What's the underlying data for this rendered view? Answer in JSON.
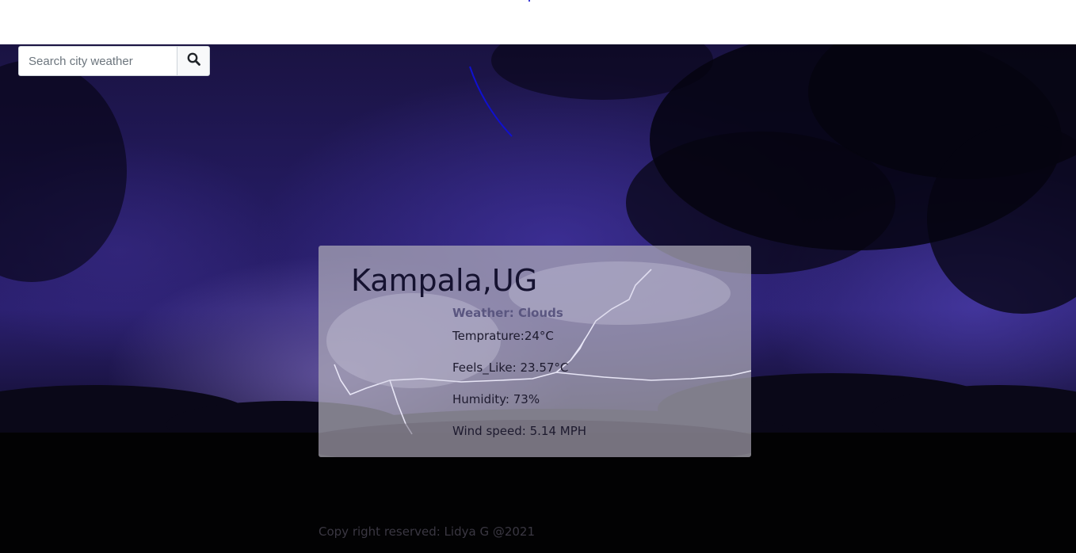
{
  "search": {
    "placeholder": "Search city weather",
    "button_icon": "search-icon"
  },
  "weather": {
    "city": "Kampala,UG",
    "condition_label": "Weather: ",
    "condition": "Clouds",
    "temperature": "Temprature:24°C",
    "feels_like": "Feels_Like: 23.57°C",
    "humidity": "Humidity: 73%",
    "wind_speed": "Wind speed: 5.14 MPH"
  },
  "footer": {
    "text": "Copy right reserved: Lidya G @2021"
  },
  "colors": {
    "sky_top": "#231a5e",
    "sky_glow": "#2b2070",
    "card_overlay": "#afacb9",
    "stroke": "#1010d0"
  }
}
